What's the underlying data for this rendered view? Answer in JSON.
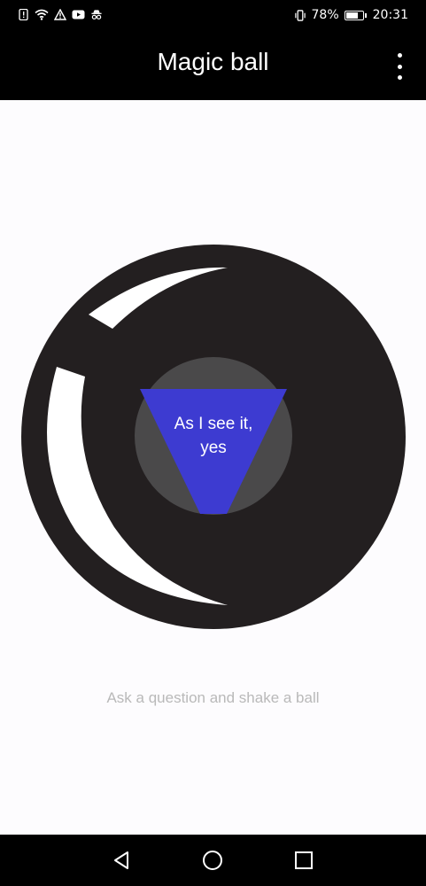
{
  "status_bar": {
    "battery_percent": "78%",
    "battery_level": 0.78,
    "time": "20:31",
    "left_icons": [
      "notification-alert-icon",
      "wifi-icon",
      "warning-icon",
      "youtube-icon",
      "incognito-icon"
    ],
    "right_icons": [
      "vibrate-icon",
      "battery-icon"
    ]
  },
  "app_bar": {
    "title": "Magic ball",
    "menu_icon": "more-vert-icon"
  },
  "magic_ball": {
    "answer_line1": "As I see it,",
    "answer_line2": "yes",
    "ball_color": "#231f20",
    "window_color": "#4a494a",
    "triangle_color": "#3d3bd1"
  },
  "hint": "Ask a question and shake a ball",
  "nav_bar": {
    "back_icon": "back-triangle-icon",
    "home_icon": "home-circle-icon",
    "recents_icon": "recents-square-icon"
  }
}
